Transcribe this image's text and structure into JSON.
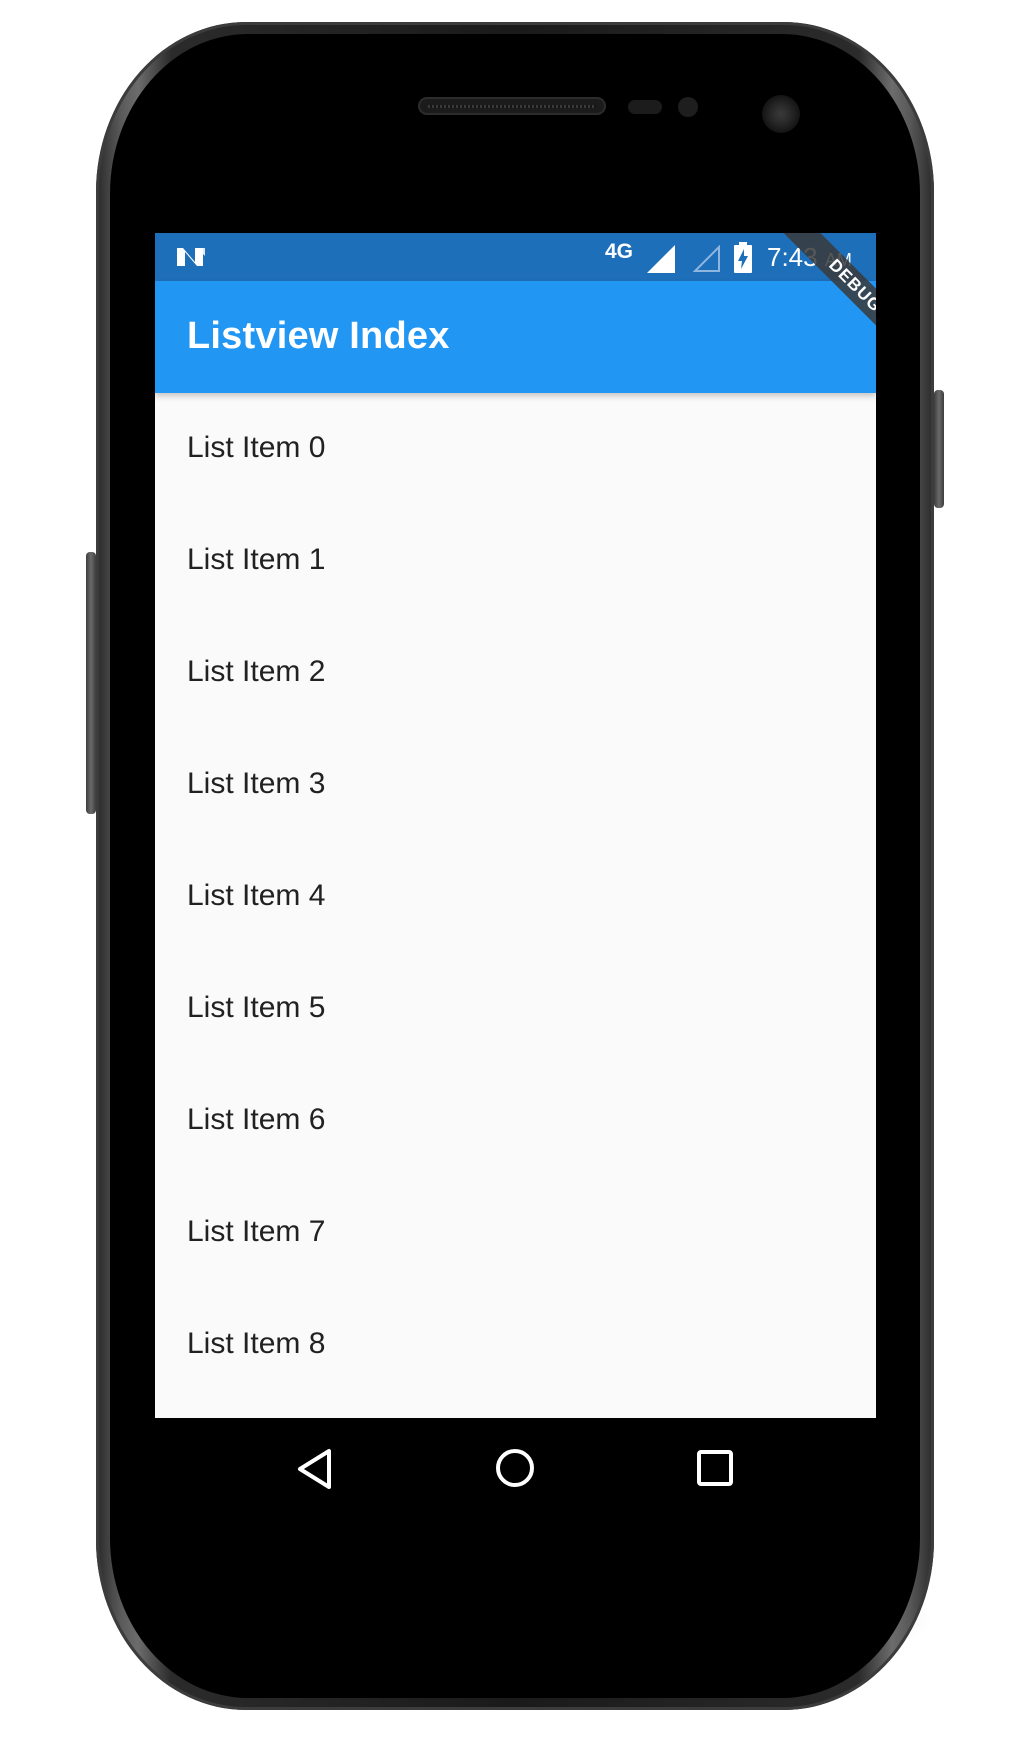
{
  "status_bar": {
    "network": "4G",
    "time": "7:43",
    "ampm": "AM",
    "icons": [
      "n-logo-icon",
      "signal-icon",
      "signal-empty-icon",
      "battery-charging-icon"
    ]
  },
  "app_bar": {
    "title": "Listview Index"
  },
  "debug_banner": "DEBUG",
  "list": {
    "items": [
      {
        "label": "List Item 0"
      },
      {
        "label": "List Item 1"
      },
      {
        "label": "List Item 2"
      },
      {
        "label": "List Item 3"
      },
      {
        "label": "List Item 4"
      },
      {
        "label": "List Item 5"
      },
      {
        "label": "List Item 6"
      },
      {
        "label": "List Item 7"
      },
      {
        "label": "List Item 8"
      }
    ]
  },
  "nav_bar": {
    "icons": [
      "back-icon",
      "home-icon",
      "recents-icon"
    ]
  },
  "colors": {
    "status_bar": "#1e6fba",
    "app_bar": "#2196f3",
    "background": "#fafafa",
    "text": "#212121"
  }
}
